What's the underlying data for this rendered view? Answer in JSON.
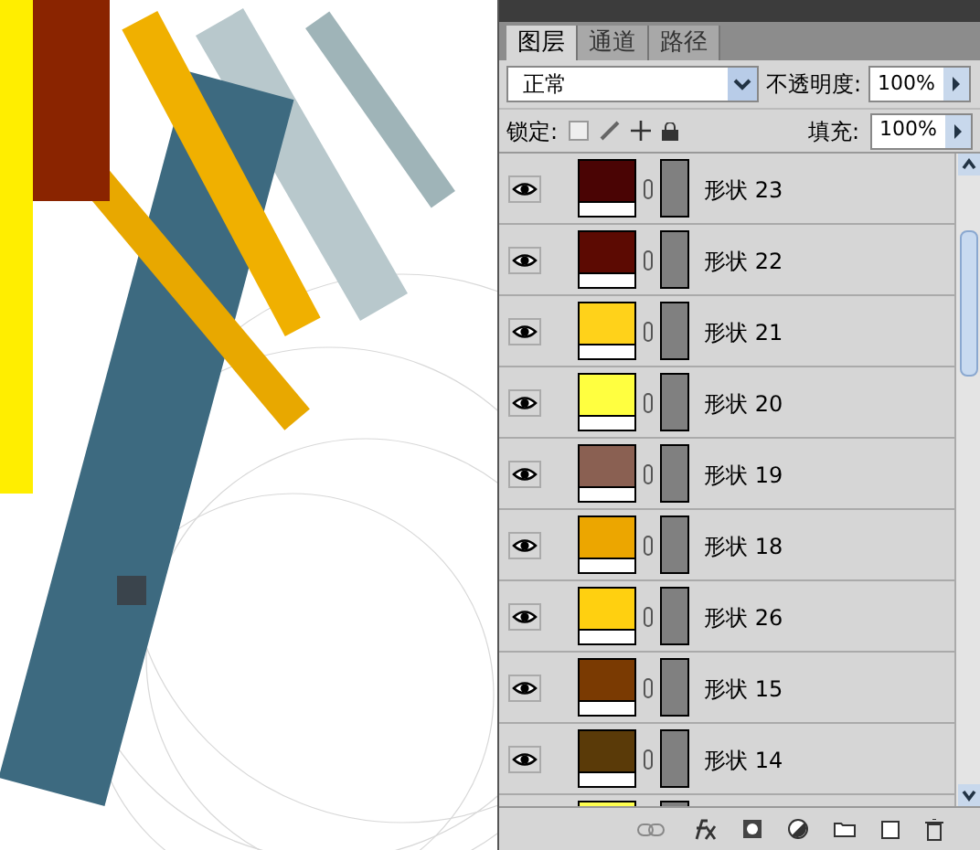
{
  "tabs": [
    {
      "label": "图层",
      "selected": true
    },
    {
      "label": "通道",
      "selected": false
    },
    {
      "label": "路径",
      "selected": false
    }
  ],
  "blend_mode": {
    "value": "正常"
  },
  "opacity": {
    "label": "不透明度:",
    "value": "100%"
  },
  "lock": {
    "label": "锁定:"
  },
  "fill": {
    "label": "填充:",
    "value": "100%"
  },
  "layers": [
    {
      "name": "形状 23",
      "color": "#4a0404",
      "visible": true
    },
    {
      "name": "形状 22",
      "color": "#5c0a02",
      "visible": true
    },
    {
      "name": "形状 21",
      "color": "#ffd21a",
      "visible": true
    },
    {
      "name": "形状 20",
      "color": "#ffff40",
      "visible": true
    },
    {
      "name": "形状 19",
      "color": "#8a6052",
      "visible": true
    },
    {
      "name": "形状 18",
      "color": "#eca600",
      "visible": true
    },
    {
      "name": "形状 26",
      "color": "#ffd010",
      "visible": true
    },
    {
      "name": "形状 15",
      "color": "#7a3a02",
      "visible": true
    },
    {
      "name": "形状 14",
      "color": "#5a3a08",
      "visible": true
    },
    {
      "color": "#ffff50"
    }
  ]
}
